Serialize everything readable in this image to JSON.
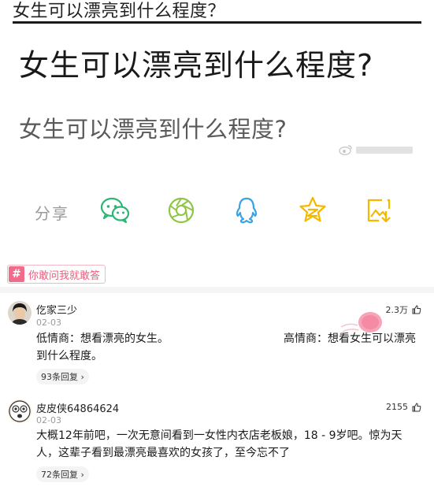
{
  "header": {
    "title": "女生可以漂亮到什么程度？"
  },
  "image": {
    "title_large": "女生可以漂亮到什么程度?",
    "title_medium": "女生可以漂亮到什么程度?"
  },
  "share": {
    "label": "分享",
    "icons": [
      "wechat-icon",
      "moments-icon",
      "qq-icon",
      "qzone-icon",
      "save-image-icon"
    ],
    "accent": "#2bb673"
  },
  "topic": {
    "hash": "#",
    "label": "你敢问我就敢答",
    "color": "#f26b8a"
  },
  "comments": [
    {
      "username": "仡家三少",
      "date": "02-03",
      "likes": "2.3万",
      "text_left": "低情商：想看漂亮的女生。",
      "text_right": "高情商：想看女生可以漂亮",
      "text_cont": "到什么程度。",
      "replies": "93条回复 ›"
    },
    {
      "username": "皮皮侠64864624",
      "date": "02-03",
      "likes": "2155",
      "text": "大概12年前吧，一次无意间看到一女性内衣店老板娘，18 - 9岁吧。惊为天人，这辈子看到最漂亮最喜欢的女孩了，至今忘不了",
      "replies": "72条回复 ›"
    }
  ]
}
